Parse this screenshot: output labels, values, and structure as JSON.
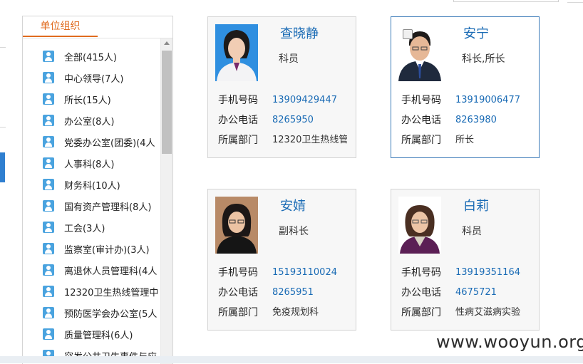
{
  "sidebar": {
    "title": "单位组织",
    "items": [
      {
        "label": "全部(415人)"
      },
      {
        "label": "中心领导(7人)"
      },
      {
        "label": "所长(15人)"
      },
      {
        "label": "办公室(8人)"
      },
      {
        "label": "党委办公室(团委)(4人"
      },
      {
        "label": "人事科(8人)"
      },
      {
        "label": "财务科(10人)"
      },
      {
        "label": "国有资产管理科(8人)"
      },
      {
        "label": "工会(3人)"
      },
      {
        "label": "监察室(审计办)(3人)"
      },
      {
        "label": "离退休人员管理科(4人"
      },
      {
        "label": "12320卫生热线管理中"
      },
      {
        "label": "预防医学会办公室(5人"
      },
      {
        "label": "质量管理科(6人)"
      },
      {
        "label": "突发公共卫生事件与应"
      }
    ]
  },
  "field_labels": {
    "mobile": "手机号码",
    "office_phone": "办公电话",
    "department": "所属部门"
  },
  "cards": [
    {
      "name": "查晓静",
      "title": "科员",
      "mobile": "13909429447",
      "office_phone": "8265950",
      "department": "12320卫生热线管"
    },
    {
      "name": "安宁",
      "title": "科长,所长",
      "mobile": "13919006477",
      "office_phone": "8263980",
      "department": "所长"
    },
    {
      "name": "安婧",
      "title": "副科长",
      "mobile": "15193110024",
      "office_phone": "8265951",
      "department": "免疫规划科"
    },
    {
      "name": "白莉",
      "title": "科员",
      "mobile": "13919351164",
      "office_phone": "4675721",
      "department": "性病艾滋病实验"
    }
  ],
  "watermark": "www.wooyun.org",
  "colors": {
    "accent_orange": "#e06b1f",
    "link_blue": "#1a6bb5",
    "selected_border": "#3b7ab8",
    "user_icon": "#4aa3df"
  }
}
